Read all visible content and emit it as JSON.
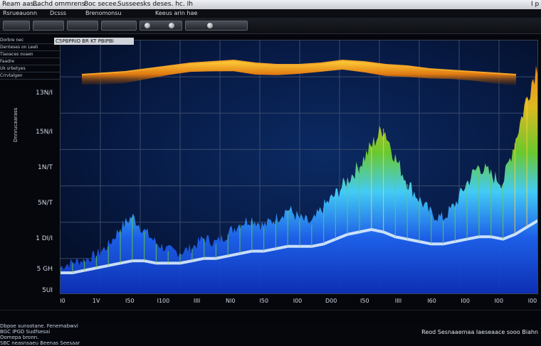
{
  "window": {
    "title_items": [
      "Ream aas...",
      "Bachd ommrens",
      "Boc secee.",
      "Susseesks deses. hc. Ih"
    ],
    "title_right": "I p",
    "buttons": [
      "_",
      "□",
      "x"
    ]
  },
  "menu": {
    "items": [
      "Rsrueauonn",
      "Dcsss",
      "Brenomonsu",
      "Keeus arin hae"
    ]
  },
  "sidebar": {
    "lines": [
      "Dorbre nec",
      "Denteses on Leeli",
      "Tiaoaces ovaen",
      "Faadre",
      "Uk srbetyes",
      "Crrvtalgen"
    ]
  },
  "plot": {
    "label": "C5PBPRIO BR KT PBIPBI",
    "y_axis_label": "Dnnrucaarass"
  },
  "status": {
    "left_lines": [
      "Dbpoe sunsotane. Fenemabwvi",
      "BGC IPGD Sudfsesai",
      "Oomepa bronn.",
      "SBC neasnsaeu Beenas Seesaar"
    ],
    "right": "Reod Sesnaaemaa Iaeseaace sooo Biahn"
  },
  "colors": {
    "ridge": "#f4a62a",
    "green": "#6fd12c",
    "cyan": "#47d0ff",
    "blue": "#1a56e0",
    "grid": "#3b4b6b"
  },
  "chart_data": {
    "type": "area",
    "ytick_labels": [
      "13N/I",
      "15N/I",
      "1N/T",
      "5N/T",
      "1 DI/I",
      "5 GH",
      "5UI"
    ],
    "xtick_labels": [
      "I0",
      "1V",
      "I50",
      "I100",
      "IIII",
      "NI0",
      "I50",
      "I00",
      "D00",
      "I50",
      "IIII",
      "I60",
      "I00",
      "I00",
      "I00"
    ],
    "grid": true,
    "top_band": {
      "name": "",
      "x": [
        0,
        1,
        2,
        3,
        4,
        5,
        6,
        7,
        8,
        9,
        10,
        11,
        12,
        13,
        14,
        15,
        16,
        17,
        18,
        19,
        20
      ],
      "values": [
        0.86,
        0.87,
        0.88,
        0.9,
        0.92,
        0.94,
        0.95,
        0.96,
        0.94,
        0.93,
        0.93,
        0.94,
        0.96,
        0.95,
        0.93,
        0.92,
        0.9,
        0.89,
        0.88,
        0.87,
        0.86
      ]
    },
    "spectrum": {
      "x": [
        0,
        1,
        2,
        3,
        4,
        5,
        6,
        7,
        8,
        9,
        10,
        11,
        12,
        13,
        14,
        15,
        16,
        17,
        18,
        19,
        20,
        21,
        22,
        23,
        24,
        25,
        26,
        27,
        28,
        29,
        30,
        31,
        32,
        33,
        34,
        35,
        36,
        37,
        38,
        39,
        40
      ],
      "values": [
        0.1,
        0.12,
        0.13,
        0.15,
        0.19,
        0.26,
        0.31,
        0.25,
        0.2,
        0.17,
        0.16,
        0.18,
        0.22,
        0.2,
        0.24,
        0.28,
        0.3,
        0.27,
        0.3,
        0.34,
        0.3,
        0.28,
        0.35,
        0.4,
        0.46,
        0.52,
        0.6,
        0.68,
        0.55,
        0.45,
        0.38,
        0.32,
        0.3,
        0.36,
        0.45,
        0.52,
        0.48,
        0.45,
        0.62,
        0.8,
        0.96
      ],
      "base": [
        0.08,
        0.08,
        0.09,
        0.1,
        0.11,
        0.12,
        0.13,
        0.13,
        0.12,
        0.12,
        0.12,
        0.13,
        0.14,
        0.14,
        0.15,
        0.16,
        0.17,
        0.17,
        0.18,
        0.19,
        0.19,
        0.19,
        0.2,
        0.22,
        0.24,
        0.25,
        0.26,
        0.25,
        0.23,
        0.22,
        0.21,
        0.2,
        0.2,
        0.21,
        0.22,
        0.23,
        0.23,
        0.22,
        0.24,
        0.27,
        0.3
      ]
    }
  }
}
